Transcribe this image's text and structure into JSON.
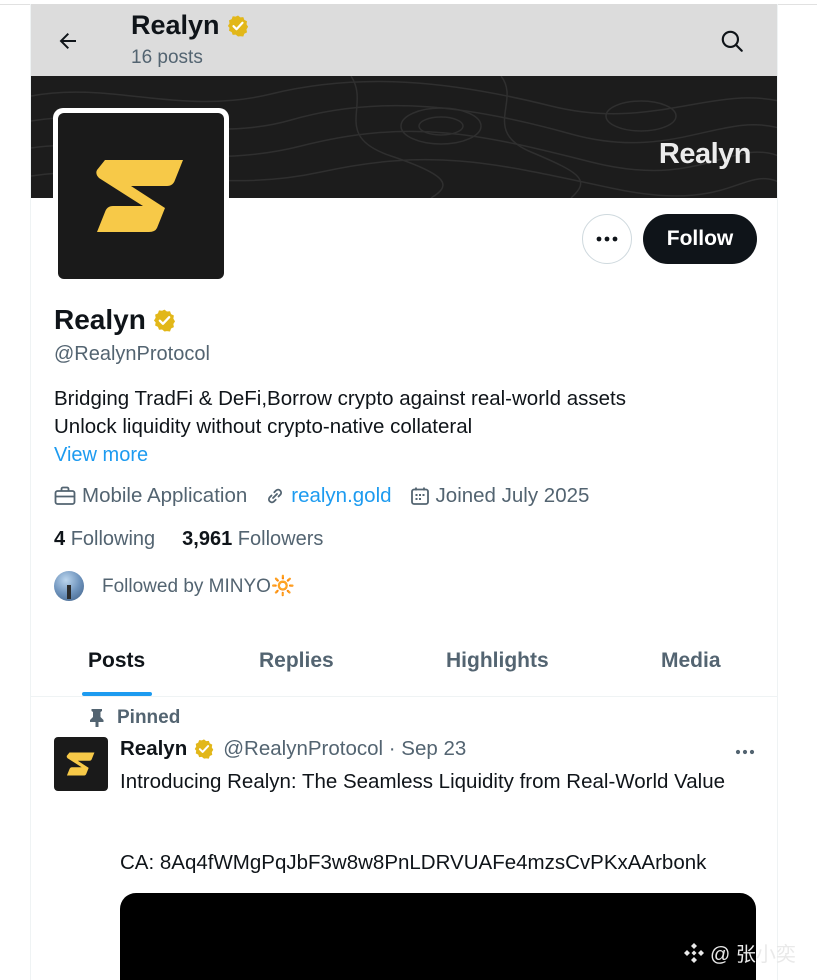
{
  "header": {
    "title": "Realyn",
    "posts_count": "16 posts"
  },
  "banner": {
    "wordmark": "Realyn"
  },
  "actions": {
    "follow_label": "Follow"
  },
  "profile": {
    "name": "Realyn",
    "handle": "@RealynProtocol",
    "bio_line1": "Bridging TradFi & DeFi,Borrow crypto against real-world assets",
    "bio_line2": "Unlock liquidity without crypto-native collateral",
    "view_more": "View more",
    "category": "Mobile Application",
    "website": "realyn.gold",
    "joined": "Joined July 2025",
    "following_count": "4",
    "following_label": "Following",
    "followers_count": "3,961",
    "followers_label": "Followers",
    "followed_by": "Followed by MINYO🔆"
  },
  "tabs": [
    {
      "label": "Posts",
      "active": true
    },
    {
      "label": "Replies",
      "active": false
    },
    {
      "label": "Highlights",
      "active": false
    },
    {
      "label": "Media",
      "active": false
    }
  ],
  "pinned_post": {
    "pinned_label": "Pinned",
    "author_name": "Realyn",
    "author_handle_date": "@RealynProtocol · Sep 23",
    "text": "Introducing Realyn: The Seamless Liquidity from Real-World Value",
    "ca_text": "CA: 8Aq4fWMgPqJbF3w8w8PnLDRVUAFe4mzsCvPKxAArbonk"
  },
  "watermark": {
    "text": "@ 张小奕"
  },
  "colors": {
    "accent": "#1d9bf0",
    "brand_yellow": "#f7c948",
    "verified_gold": "#e2b719",
    "text_primary": "#0f1419",
    "text_secondary": "#536471"
  },
  "icons": {
    "back": "arrow-left-icon",
    "search": "search-icon",
    "verified": "verified-badge-icon",
    "more": "more-horizontal-icon",
    "category": "briefcase-icon",
    "link": "link-icon",
    "calendar": "calendar-icon",
    "pin": "pin-icon"
  }
}
